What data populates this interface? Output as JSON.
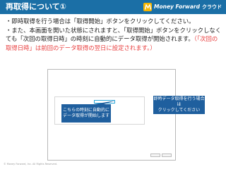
{
  "header": {
    "title": "再取得について①",
    "brand_name": "Money Forward",
    "brand_suffix": "クラウド"
  },
  "body": {
    "line1": "・即時取得を行う場合は「取得開始」ボタンをクリックしてください。",
    "line2": "・また、本画面を開いた状態にされますと、「取得開始」ボタンをクリックしなくても「次回の取得日時」の時刻に自動的にデータ取得が開始されます。",
    "note": "（「次回の取得日時」は前回のデータ取得の翌日に設定されます。）"
  },
  "dialog": {
    "fetch_button_label": "取得開始"
  },
  "callouts": {
    "auto": {
      "line1": "こちらの時刻に自動的に",
      "line2": "データ取得が開始します"
    },
    "manual": {
      "line1": "即時データ取得を行う場合は",
      "line2": "クリックしてください"
    }
  },
  "footer": {
    "copyright": "© Money Forward, Inc. All Rights Reserved."
  },
  "colors": {
    "header_bg": "#1b6fa6",
    "callout_bg": "#1f5f9e",
    "highlight_red": "#e83e3e",
    "highlight_blue": "#2ea6d8",
    "brand_yellow": "#f7b500"
  }
}
